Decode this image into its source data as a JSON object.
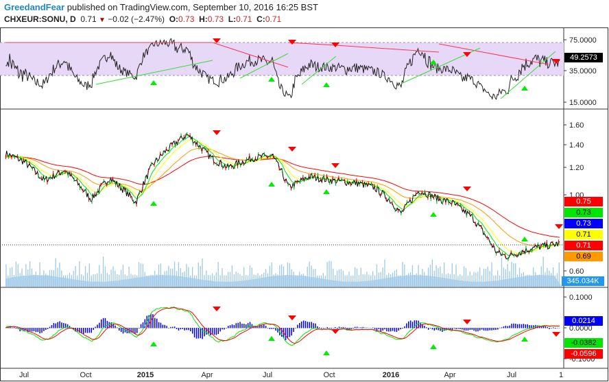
{
  "header": {
    "brand": "GreedandFear",
    "published": "published on TradingView.com, September 10, 2016 16:25 BST",
    "symbol": "CHXEUR:SONU, D",
    "last": "0.71",
    "change": "−0.02 (−2.47%)",
    "o_label": "O:",
    "o": "0.73",
    "h_label": "H:",
    "h": "0.73",
    "l_label": "L:",
    "l": "0.71",
    "c_label": "C:",
    "c": "0.71"
  },
  "rsi_axis": {
    "ticks": [
      "75.0000",
      "35.0000",
      "15.0000"
    ],
    "current": "49.2573"
  },
  "price_axis": {
    "ticks": [
      "1.60",
      "1.40",
      "1.20",
      "1.00",
      "0.60"
    ],
    "badges": [
      {
        "text": "0.75",
        "bg": "#ff0000",
        "fg": "#fff"
      },
      {
        "text": "0.73",
        "bg": "#00e600",
        "fg": "#000"
      },
      {
        "text": "0.73",
        "bg": "#0000ff",
        "fg": "#fff"
      },
      {
        "text": "0.71",
        "bg": "#ffff00",
        "fg": "#000"
      },
      {
        "text": "0.71",
        "bg": "#ff0000",
        "fg": "#fff"
      },
      {
        "text": "0.69",
        "bg": "#ff9900",
        "fg": "#000"
      }
    ],
    "volume": "345.034K"
  },
  "macd_axis": {
    "ticks": [
      "0.1000",
      "0.0000",
      "-0.1000"
    ],
    "badges": [
      {
        "text": "0.0214",
        "bg": "#0000ff",
        "fg": "#fff"
      },
      {
        "text": "-0.0382",
        "bg": "#00e600",
        "fg": "#000"
      },
      {
        "text": "-0.0596",
        "bg": "#ff0000",
        "fg": "#fff"
      }
    ]
  },
  "time_axis": [
    "Jul",
    "Oct",
    "2015",
    "Apr",
    "Jul",
    "Oct",
    "2016",
    "Apr",
    "Jul",
    "1"
  ],
  "chart_data": {
    "type": "line",
    "title": "CHXEUR:SONU, D",
    "x_months_since_jul_2014": [
      -0.9,
      0,
      1,
      2,
      3.3,
      4.2,
      5,
      5.5,
      6.3,
      7,
      8,
      9.2,
      10,
      11.2,
      12.2,
      13,
      14,
      15.2,
      16.4,
      17.2,
      18,
      18.5,
      19.4,
      20.4,
      21,
      22,
      23.2,
      23.7,
      25,
      26.3
    ],
    "price": [
      1.32,
      1.25,
      1.1,
      1.18,
      0.97,
      1.12,
      1.02,
      0.95,
      1.22,
      1.35,
      1.5,
      1.28,
      1.2,
      1.28,
      1.3,
      1.05,
      1.13,
      1.1,
      1.08,
      1.05,
      0.96,
      0.88,
      1.03,
      0.97,
      0.95,
      0.86,
      0.68,
      0.66,
      0.7,
      0.72
    ],
    "ylim": [
      0.55,
      1.75
    ]
  }
}
